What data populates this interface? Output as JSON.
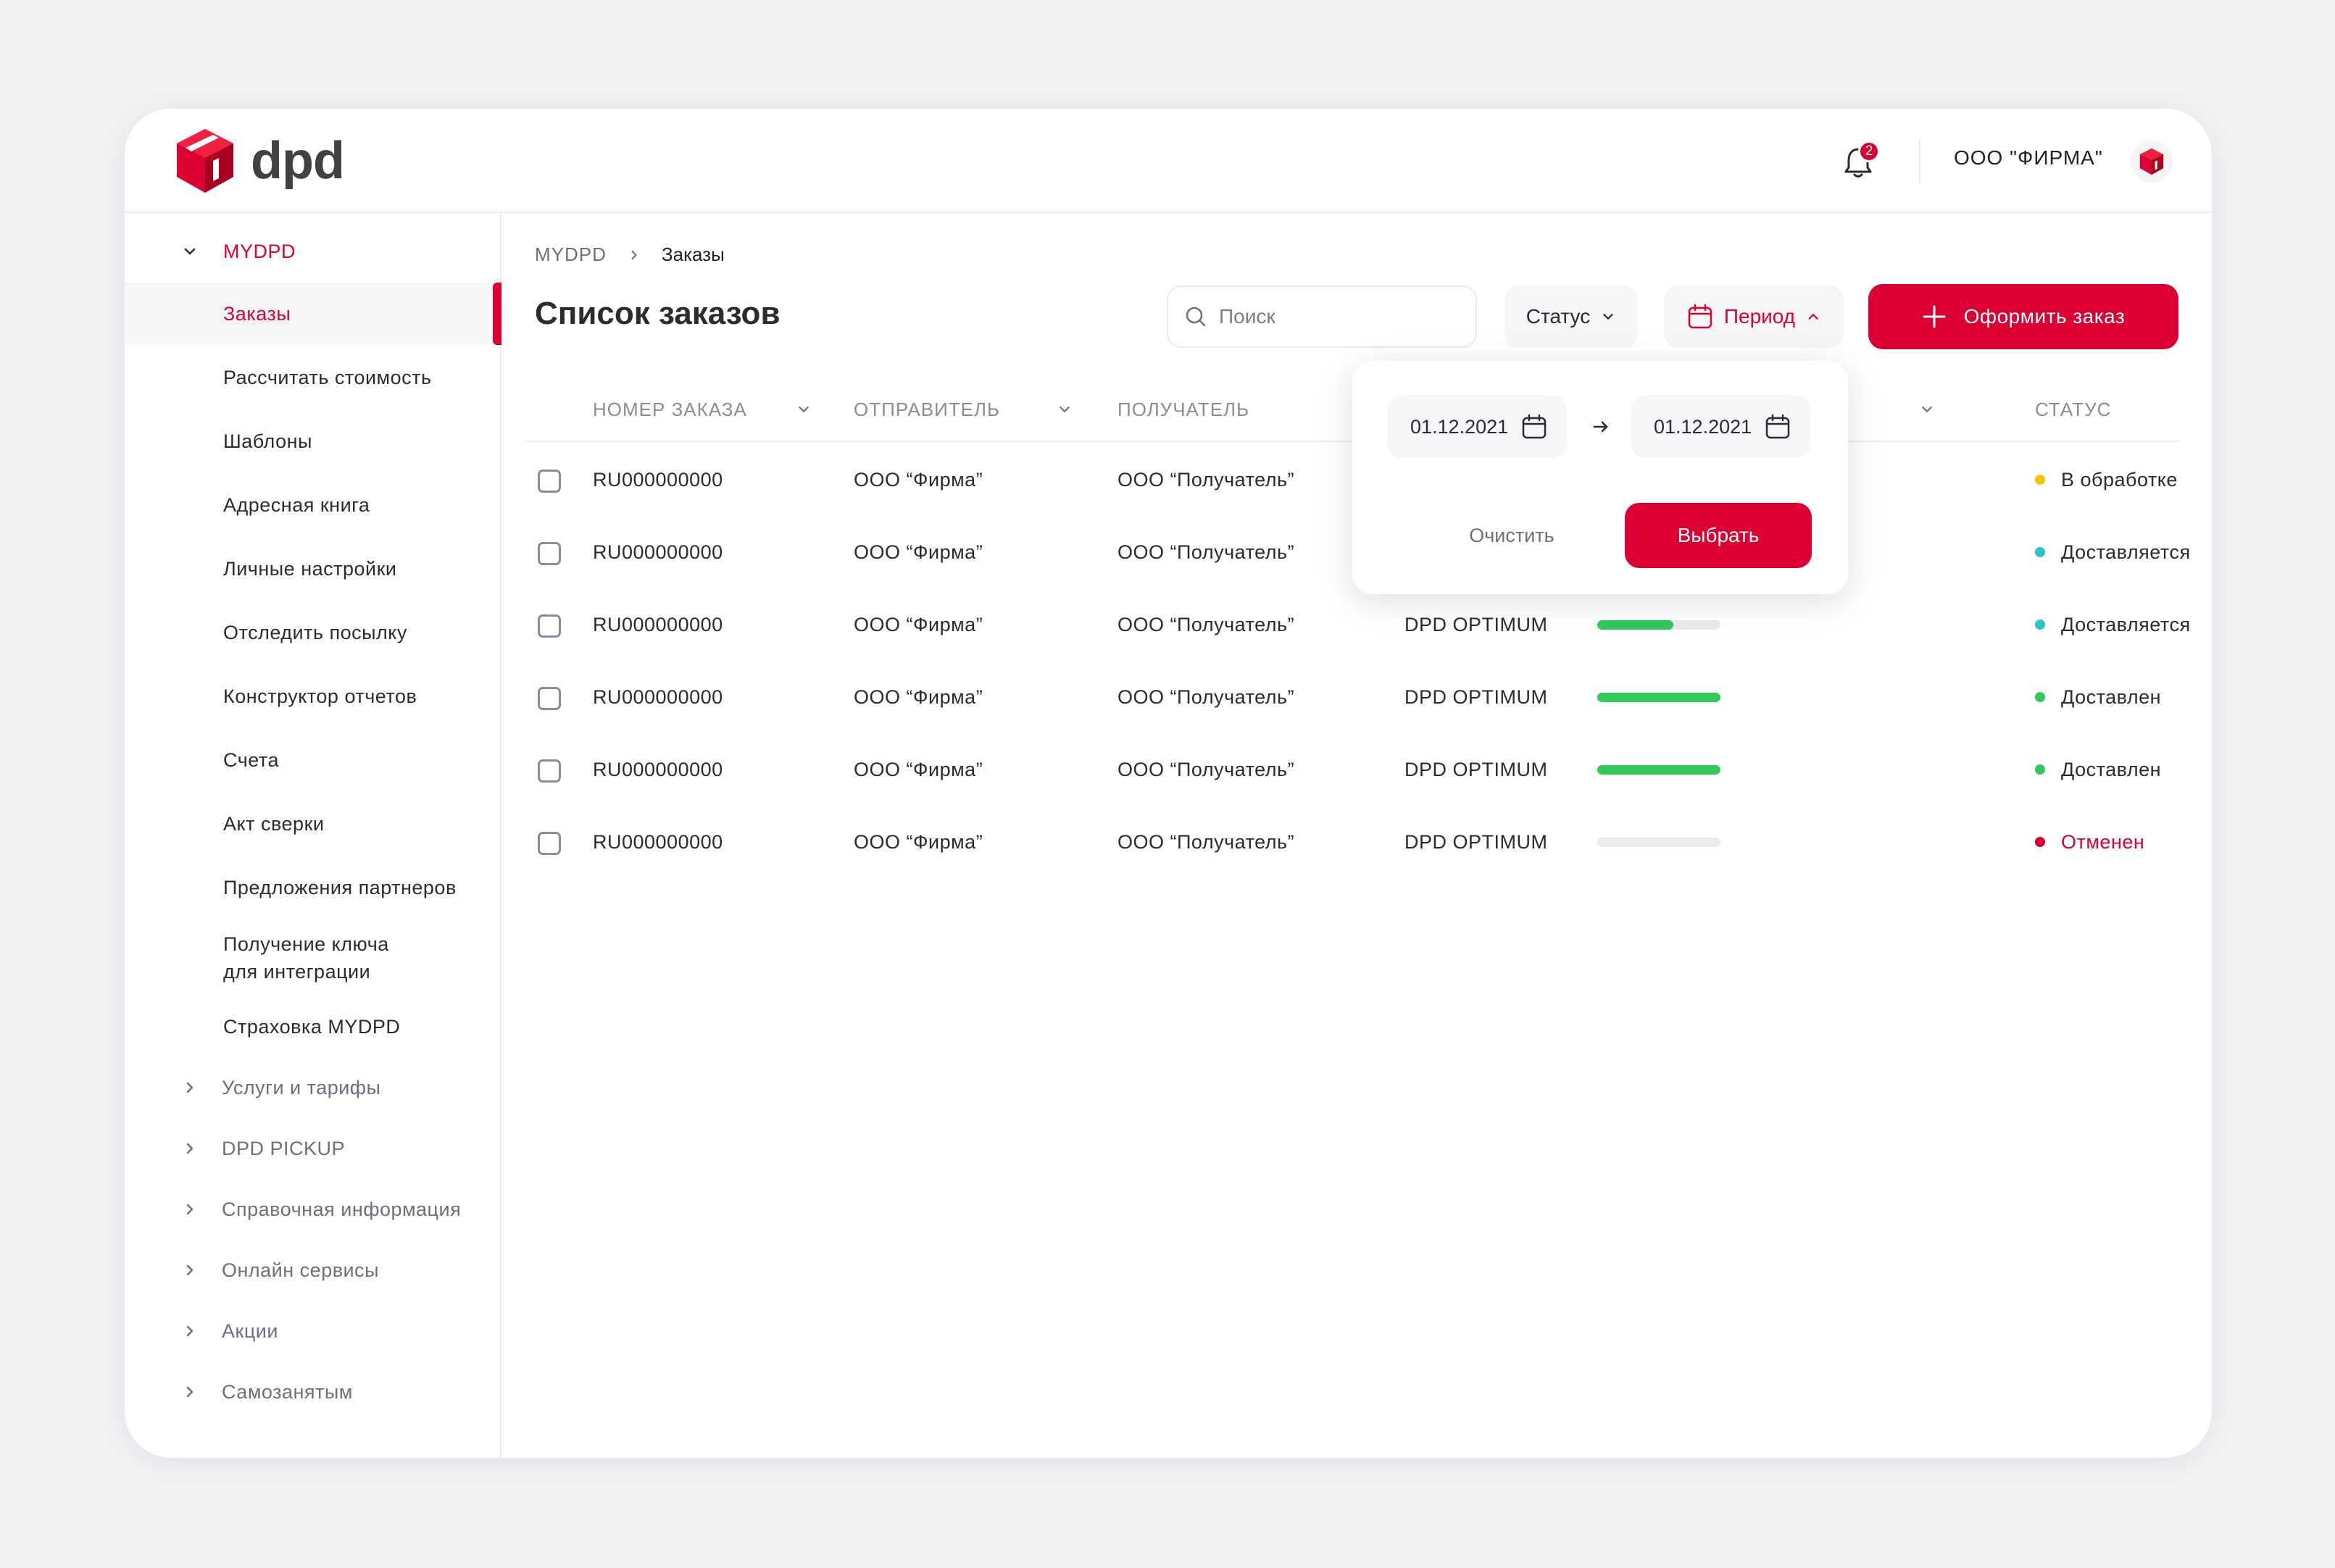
{
  "header": {
    "logo_text": "dpd",
    "notification_count": "2",
    "company_name": "ООО \"ФИРМА\""
  },
  "colors": {
    "brand": "#dc0032",
    "green": "#32c85a",
    "yellow": "#f5c400",
    "teal": "#2ec4c4"
  },
  "sidebar": {
    "section_open": "MYDPD",
    "sub_items": [
      "Заказы",
      "Рассчитать стоимость",
      "Шаблоны",
      "Адресная книга",
      "Личные настройки",
      "Отследить посылку",
      "Конструктор отчетов",
      "Счета",
      "Акт сверки",
      "Предложения партнеров",
      "Получение ключа\nдля интеграции",
      "Страховка MYDPD"
    ],
    "sections": [
      "Услуги и тарифы",
      "DPD PICKUP",
      "Справочная информация",
      "Онлайн сервисы",
      "Акции",
      "Самозанятым"
    ]
  },
  "breadcrumb": {
    "root": "MYDPD",
    "current": "Заказы"
  },
  "page": {
    "title": "Список заказов"
  },
  "toolbar": {
    "search_placeholder": "Поиск",
    "status_label": "Статус",
    "period_label": "Период",
    "create_label": "Оформить заказ"
  },
  "table": {
    "headers": {
      "order_no": "НОМЕР ЗАКАЗА",
      "sender": "ОТПРАВИТЕЛЬ",
      "recipient": "ПОЛУЧАТЕЛЬ",
      "status": "СТАТУС"
    },
    "rows": [
      {
        "order_no": "RU000000000",
        "sender": "ООО “Фирма”",
        "recipient": "ООО “Получатель”",
        "service": "",
        "progress": null,
        "status": "В обработке",
        "status_color": "#f5c400"
      },
      {
        "order_no": "RU000000000",
        "sender": "ООО “Фирма”",
        "recipient": "ООО “Получатель”",
        "service": "",
        "progress": null,
        "status": "Доставляется",
        "status_color": "#2ec4c4"
      },
      {
        "order_no": "RU000000000",
        "sender": "ООО “Фирма”",
        "recipient": "ООО “Получатель”",
        "service": "DPD OPTIMUM",
        "progress": 0.62,
        "status": "Доставляется",
        "status_color": "#2ec4c4"
      },
      {
        "order_no": "RU000000000",
        "sender": "ООО “Фирма”",
        "recipient": "ООО “Получатель”",
        "service": "DPD OPTIMUM",
        "progress": 1.0,
        "status": "Доставлен",
        "status_color": "#32c85a"
      },
      {
        "order_no": "RU000000000",
        "sender": "ООО “Фирма”",
        "recipient": "ООО “Получатель”",
        "service": "DPD OPTIMUM",
        "progress": 1.0,
        "status": "Доставлен",
        "status_color": "#32c85a"
      },
      {
        "order_no": "RU000000000",
        "sender": "ООО “Фирма”",
        "recipient": "ООО “Получатель”",
        "service": "DPD OPTIMUM",
        "progress": 0.0,
        "status": "Отменен",
        "status_color": "#dc0032"
      }
    ]
  },
  "period_popup": {
    "date_from": "01.12.2021",
    "date_to": "01.12.2021",
    "clear_label": "Очистить",
    "apply_label": "Выбрать"
  }
}
